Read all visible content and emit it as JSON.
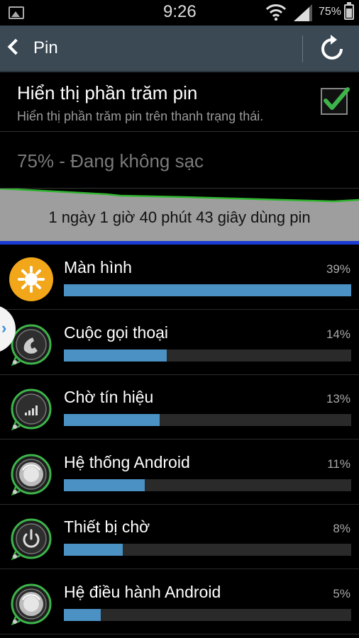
{
  "status_bar": {
    "time": "9:26",
    "battery_text": "75%",
    "battery_level": 0.75
  },
  "action_bar": {
    "title": "Pin",
    "back_icon": "chevron-left-icon",
    "refresh_icon": "refresh-icon"
  },
  "percentage_setting": {
    "title": "Hiển thị phần trăm pin",
    "subtitle": "Hiển thị phần trăm pin trên thanh trạng thái.",
    "checked": true
  },
  "battery_status": "75% - Đang không sạc",
  "usage_summary": "1 ngày 1 giờ 40 phút 43 giây dùng pin",
  "usage_items": [
    {
      "name": "Màn hình",
      "percent_text": "39%",
      "percent": 39,
      "icon": "brightness-icon"
    },
    {
      "name": "Cuộc gọi thoại",
      "percent_text": "14%",
      "percent": 14,
      "icon": "phone-icon"
    },
    {
      "name": "Chờ tín hiệu",
      "percent_text": "13%",
      "percent": 13,
      "icon": "signal-icon"
    },
    {
      "name": "Hệ thống Android",
      "percent_text": "11%",
      "percent": 11,
      "icon": "android-system-icon"
    },
    {
      "name": "Thiết bị chờ",
      "percent_text": "8%",
      "percent": 8,
      "icon": "power-icon"
    },
    {
      "name": "Hệ điều hành Android",
      "percent_text": "5%",
      "percent": 5,
      "icon": "android-os-icon"
    }
  ],
  "colors": {
    "accent_bar": "#4b91c4",
    "action_bar": "#3a4954",
    "graph_line": "#2fb52f",
    "check": "#3db54a"
  }
}
